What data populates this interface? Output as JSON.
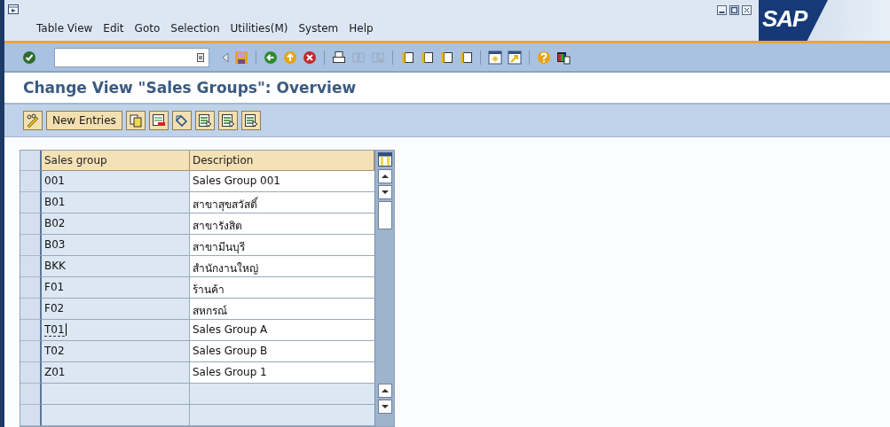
{
  "menu_bar": {
    "items": [
      {
        "label": "Table View"
      },
      {
        "label": "Edit"
      },
      {
        "label": "Goto"
      },
      {
        "label": "Selection"
      },
      {
        "label": "Utilities(M)"
      },
      {
        "label": "System"
      },
      {
        "label": "Help"
      }
    ]
  },
  "logo": "SAP",
  "title": "Change View \"Sales Groups\": Overview",
  "app_toolbar": {
    "new_entries_button": "New Entries"
  },
  "table": {
    "columns": [
      "Sales group",
      "Description"
    ],
    "rows": [
      {
        "sales_group": "001",
        "description": "Sales Group 001",
        "focused": false
      },
      {
        "sales_group": "B01",
        "description": "สาขาสุขสวัสดิ์",
        "focused": false
      },
      {
        "sales_group": "B02",
        "description": "สาขารังสิต",
        "focused": false
      },
      {
        "sales_group": "B03",
        "description": "สาขามีนบุรี",
        "focused": false
      },
      {
        "sales_group": "BKK",
        "description": "สำนักงานใหญ่",
        "focused": false
      },
      {
        "sales_group": "F01",
        "description": "ร้านค้า",
        "focused": false
      },
      {
        "sales_group": "F02",
        "description": "สหกรณ์",
        "focused": false
      },
      {
        "sales_group": "T01",
        "description": "Sales Group A",
        "focused": true
      },
      {
        "sales_group": "T02",
        "description": "Sales Group B",
        "focused": false
      },
      {
        "sales_group": "Z01",
        "description": "Sales Group 1",
        "focused": false
      }
    ]
  }
}
